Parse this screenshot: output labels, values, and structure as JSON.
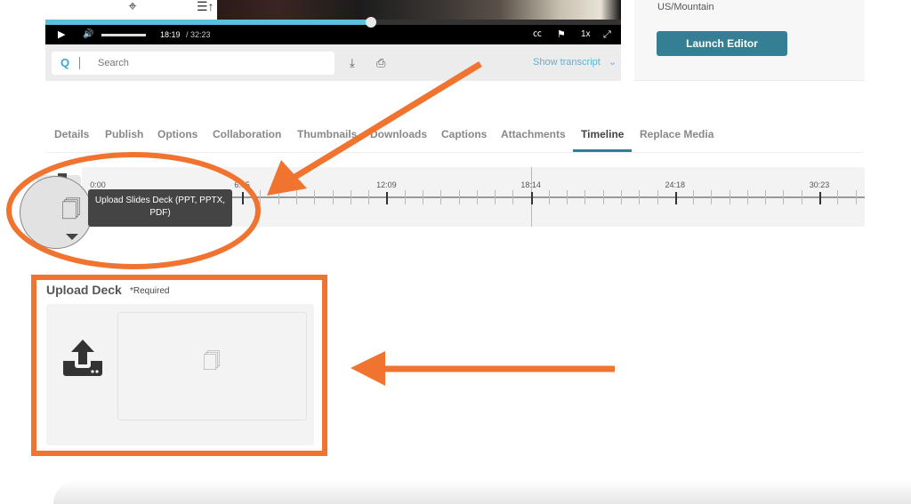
{
  "player": {
    "current_time": "18:19",
    "duration": "/ 32:23",
    "progress_fraction": 0.566,
    "volume_fraction": 1.0,
    "speed": "1x",
    "icons": {
      "target": "crosshair-icon",
      "list": "list-sort-icon",
      "play": "play-icon",
      "volume": "volume-icon",
      "cc": "closed-captions-icon",
      "flag": "flag-icon",
      "fullscreen": "fullscreen-icon"
    },
    "glyphs": {
      "target": "⌖",
      "list": "☰↑",
      "play": "▶",
      "volume": "🔊",
      "cc": "㏄",
      "flag": "⚑",
      "fullscreen": "⤢"
    }
  },
  "transcript_bar": {
    "search_placeholder": "Search",
    "search_glyph": "Q",
    "download_glyph": "⤓",
    "print_glyph": "⎙",
    "show_transcript": "Show transcript",
    "chevron": "⌄"
  },
  "side_panel": {
    "timezone": "US/Mountain",
    "launch_editor": "Launch Editor"
  },
  "tabs": [
    {
      "label": "Details",
      "active": false
    },
    {
      "label": "Publish",
      "active": false
    },
    {
      "label": "Options",
      "active": false
    },
    {
      "label": "Collaboration",
      "active": false
    },
    {
      "label": "Thumbnails",
      "active": false
    },
    {
      "label": "Downloads",
      "active": false
    },
    {
      "label": "Captions",
      "active": false
    },
    {
      "label": "Attachments",
      "active": false
    },
    {
      "label": "Timeline",
      "active": true
    },
    {
      "label": "Replace Media",
      "active": false
    }
  ],
  "timeline": {
    "labels": [
      "0:00",
      "6:05",
      "12:09",
      "18:14",
      "24:18",
      "30:23"
    ],
    "playhead_time": "18:19",
    "playhead_fraction": 0.576,
    "duration_label": "32:23"
  },
  "tooltip": {
    "text_line1": "Upload Slides Deck (PPT, PPTX,",
    "text_line2": "PDF)",
    "doc_glyph": "🗍"
  },
  "upload_deck": {
    "title": "Upload Deck",
    "required": "*Required",
    "doc_glyph": "🗍"
  },
  "annotation": {
    "color": "#f07430"
  }
}
